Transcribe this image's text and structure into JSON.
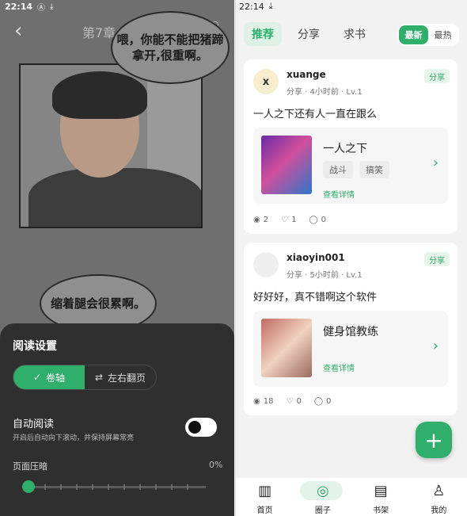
{
  "left": {
    "status": {
      "time": "22:14"
    },
    "chapter_title": "第7章：邻居",
    "bubble_1": "喂，你能不能把猪蹄拿开,很重啊。",
    "bubble_2": "缩着腿会很累啊。",
    "settings": {
      "title": "阅读设置",
      "mode_scroll": "卷轴",
      "mode_flip": "左右翻页",
      "auto_read_label": "自动阅读",
      "auto_read_sub": "开启后自动向下滚动，并保持屏幕常亮",
      "dim_label": "页面压暗",
      "dim_value": "0%"
    }
  },
  "right": {
    "status": {
      "time": "22:14"
    },
    "tabs": [
      {
        "label": "推荐"
      },
      {
        "label": "分享"
      },
      {
        "label": "求书"
      }
    ],
    "sort": {
      "newest": "最新",
      "hottest": "最热"
    },
    "posts": [
      {
        "avatar_letter": "x",
        "username": "xuange",
        "meta": "分享 · 4小时前 · Lv.1",
        "badge": "分享",
        "text": "一人之下还有人一直在跟么",
        "book_title": "一人之下",
        "tags": [
          "战斗",
          "搞笑"
        ],
        "detail": "查看详情",
        "views": "2",
        "likes": "1",
        "comments": "0"
      },
      {
        "avatar_letter": "",
        "username": "xiaoyin001",
        "meta": "分享 · 5小时前 · Lv.1",
        "badge": "分享",
        "text": "好好好，真不错啊这个软件",
        "book_title": "健身馆教练",
        "detail": "查看详情",
        "views": "18",
        "likes": "0",
        "comments": "0"
      }
    ],
    "nav": [
      {
        "label": "首页"
      },
      {
        "label": "圈子"
      },
      {
        "label": "书架"
      },
      {
        "label": "我的"
      }
    ]
  }
}
